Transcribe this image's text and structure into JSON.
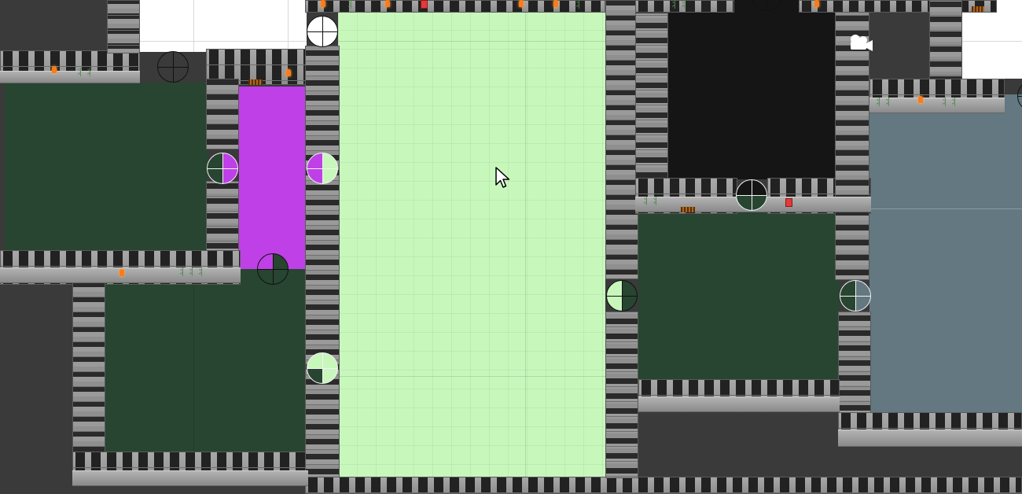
{
  "scene": {
    "room_colors": {
      "dark_green": "#274530",
      "magenta": "#bf40e6",
      "light_green": "#c8f7bc",
      "black": "#151515",
      "slate": "#637880",
      "background": "#3a3a3a",
      "white": "#ffffff"
    },
    "icons": [
      "mouse-cursor-icon",
      "camera-gizmo-icon",
      "crosshair-marker-icon",
      "torch-icon",
      "gate-icon",
      "banner-icon",
      "vine-icon"
    ]
  }
}
